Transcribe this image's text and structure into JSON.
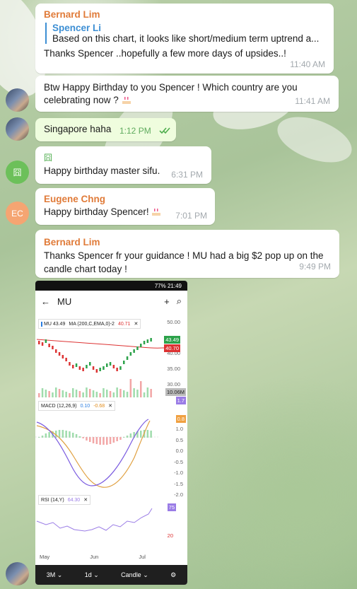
{
  "messages": [
    {
      "sender": "Bernard Lim",
      "reply_name": "Spencer Li",
      "reply_text": "Based on this chart, it looks like short/medium term uptrend a...",
      "text": "Thanks Spencer ..hopefully a few more days of upsides..!",
      "time": "11:40 AM"
    },
    {
      "text": "Btw Happy Birthday to you Spencer ! Which country are you",
      "text2": "celebrating now ?",
      "time": "11:41 AM"
    },
    {
      "text": "Singapore haha",
      "time": "1:12 PM"
    },
    {
      "sender_icon": "囧",
      "text": "Happy birthday master sifu.",
      "time": "6:31 PM",
      "avatar": "囧"
    },
    {
      "sender": "Eugene Chng",
      "text": "Happy birthday Spencer!",
      "time": "7:01 PM",
      "avatar": "EC"
    },
    {
      "sender": "Bernard Lim",
      "text": "Thanks Spencer fr your guidance ! MU had a big $2 pop up on the",
      "text2": "candle chart today !",
      "time": "9:49 PM"
    }
  ],
  "phone": {
    "status": "77% 21:49",
    "ticker": "MU",
    "legend_price": "MU 43.49",
    "legend_ma": "MA (200,C,EMA,0)-2",
    "legend_ma_val": "40.71",
    "macd_label": "MACD (12,26,9)",
    "macd_v1": "0.10",
    "macd_v2": "-0.68",
    "rsi_label": "RSI (14,Y)",
    "rsi_val": "64.30",
    "price_axis": [
      "50.00",
      "45.00",
      "40.00",
      "35.00",
      "30.00"
    ],
    "price_tags": [
      "43.49",
      "40.70"
    ],
    "volume_tag": "10.06M",
    "macd_axis": [
      "1.0",
      "0.5",
      "0.0",
      "-0.5",
      "-1.0",
      "-1.5",
      "-2.0"
    ],
    "macd_tags": [
      "1.7",
      "0.8"
    ],
    "rsi_tags": [
      "75",
      "20"
    ],
    "months": [
      "May",
      "Jun",
      "Jul"
    ],
    "bottom": [
      "3M",
      "1d",
      "Candle"
    ]
  },
  "colors": {
    "sender": "#e07b39",
    "reply": "#3d8fd4",
    "out_bubble": "#effdde",
    "check": "#4fae4e"
  }
}
